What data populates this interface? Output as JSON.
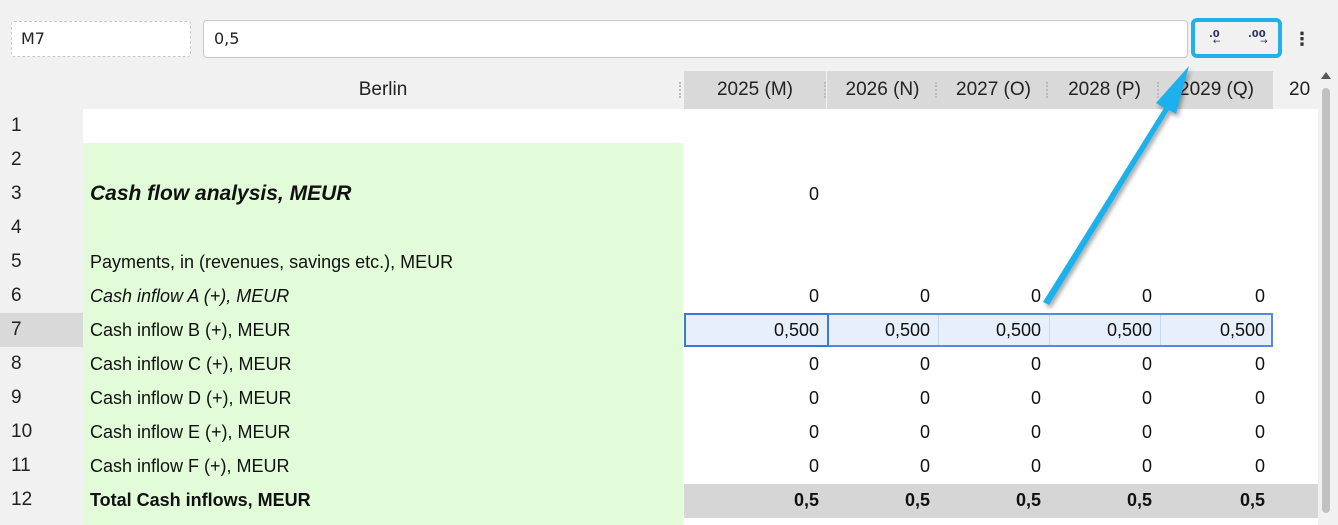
{
  "toolbar": {
    "name_box": "M7",
    "formula_value": "0,5",
    "decrease_decimal_label": ".0",
    "increase_decimal_label": ".00",
    "more_label": "⋮"
  },
  "columns": {
    "label_header": "Berlin",
    "years": [
      "2025 (M)",
      "2026 (N)",
      "2027 (O)",
      "2028 (P)",
      "2029 (Q)"
    ],
    "overflow": "20"
  },
  "rows": [
    {
      "num": "1",
      "label": "",
      "values": [
        "",
        "",
        "",
        "",
        ""
      ]
    },
    {
      "num": "2",
      "label": "",
      "values": [
        "",
        "",
        "",
        "",
        ""
      ]
    },
    {
      "num": "3",
      "label": "Cash flow analysis, MEUR",
      "values": [
        "0",
        "",
        "",
        "",
        ""
      ]
    },
    {
      "num": "4",
      "label": "",
      "values": [
        "",
        "",
        "",
        "",
        ""
      ]
    },
    {
      "num": "5",
      "label": "Payments, in (revenues, savings etc.), MEUR",
      "values": [
        "",
        "",
        "",
        "",
        ""
      ]
    },
    {
      "num": "6",
      "label": "Cash inflow A (+), MEUR",
      "values": [
        "0",
        "0",
        "0",
        "0",
        "0"
      ]
    },
    {
      "num": "7",
      "label": "Cash inflow B (+), MEUR",
      "values": [
        "0,500",
        "0,500",
        "0,500",
        "0,500",
        "0,500"
      ]
    },
    {
      "num": "8",
      "label": "Cash inflow C (+), MEUR",
      "values": [
        "0",
        "0",
        "0",
        "0",
        "0"
      ]
    },
    {
      "num": "9",
      "label": "Cash inflow D (+), MEUR",
      "values": [
        "0",
        "0",
        "0",
        "0",
        "0"
      ]
    },
    {
      "num": "10",
      "label": "Cash inflow E (+), MEUR",
      "values": [
        "0",
        "0",
        "0",
        "0",
        "0"
      ]
    },
    {
      "num": "11",
      "label": "Cash inflow F (+), MEUR",
      "values": [
        "0",
        "0",
        "0",
        "0",
        "0"
      ]
    },
    {
      "num": "12",
      "label": "Total Cash inflows, MEUR",
      "values": [
        "0,5",
        "0,5",
        "0,5",
        "0,5",
        "0,5"
      ]
    }
  ],
  "colors": {
    "label_column_bg": "#e2fcd9",
    "selection_border": "#4f8be0",
    "highlight_annotation": "#1eb1ec"
  }
}
